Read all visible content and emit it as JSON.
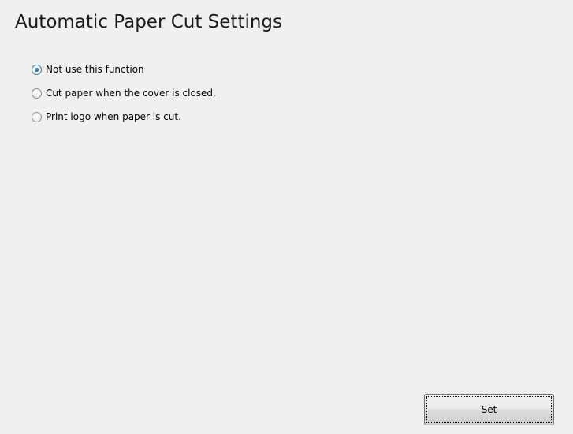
{
  "header": {
    "title": "Automatic Paper Cut Settings"
  },
  "options": [
    {
      "label": "Not use this function",
      "checked": true
    },
    {
      "label": "Cut paper when the cover is closed.",
      "checked": false
    },
    {
      "label": "Print logo when paper is cut.",
      "checked": false
    }
  ],
  "footer": {
    "set_label": "Set"
  }
}
